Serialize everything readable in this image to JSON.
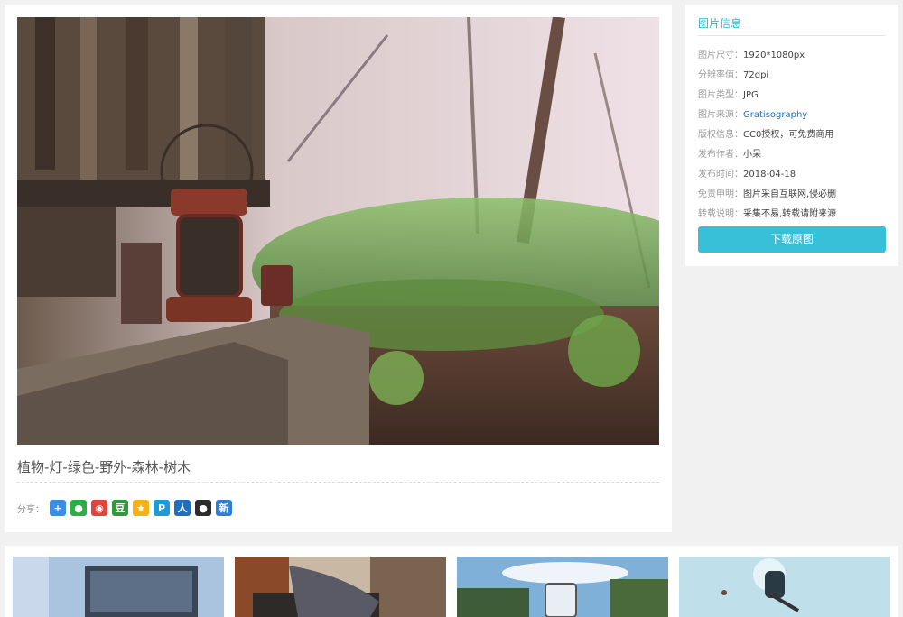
{
  "photo": {
    "title": "植物-灯-绿色-野外-森林-树木",
    "share_label": "分享："
  },
  "share_buttons": [
    {
      "name": "more",
      "glyph": "+",
      "color": "#3a8ee6"
    },
    {
      "name": "wechat",
      "glyph": "●",
      "color": "#2dae43"
    },
    {
      "name": "weibo",
      "glyph": "◉",
      "color": "#e0443a"
    },
    {
      "name": "douban",
      "glyph": "豆",
      "color": "#2f9a3a"
    },
    {
      "name": "qzone",
      "glyph": "★",
      "color": "#f3b21b"
    },
    {
      "name": "tencent-weibo",
      "glyph": "P",
      "color": "#1e9ad6"
    },
    {
      "name": "renren",
      "glyph": "人",
      "color": "#1f6fbf"
    },
    {
      "name": "qq",
      "glyph": "●",
      "color": "#2c2c2c"
    },
    {
      "name": "sina",
      "glyph": "新",
      "color": "#2f7fd0"
    }
  ],
  "info": {
    "title": "图片信息",
    "rows": [
      {
        "label": "图片尺寸：",
        "value": "1920*1080px"
      },
      {
        "label": "分辨率值：",
        "value": "72dpi"
      },
      {
        "label": "图片类型：",
        "value": "JPG"
      },
      {
        "label": "图片来源：",
        "value": "Gratisography"
      },
      {
        "label": "版权信息：",
        "value": "CC0授权，可免费商用"
      },
      {
        "label": "发布作者：",
        "value": "小呆"
      },
      {
        "label": "发布时间：",
        "value": "2018-04-18"
      },
      {
        "label": "免责申明：",
        "value": "图片采自互联网,侵必删"
      },
      {
        "label": "转载说明：",
        "value": "采集不易,转载请附来源"
      }
    ],
    "download_label": "下载原图"
  },
  "colors": {
    "accent": "#38c0d8",
    "link": "#1a73c9"
  }
}
